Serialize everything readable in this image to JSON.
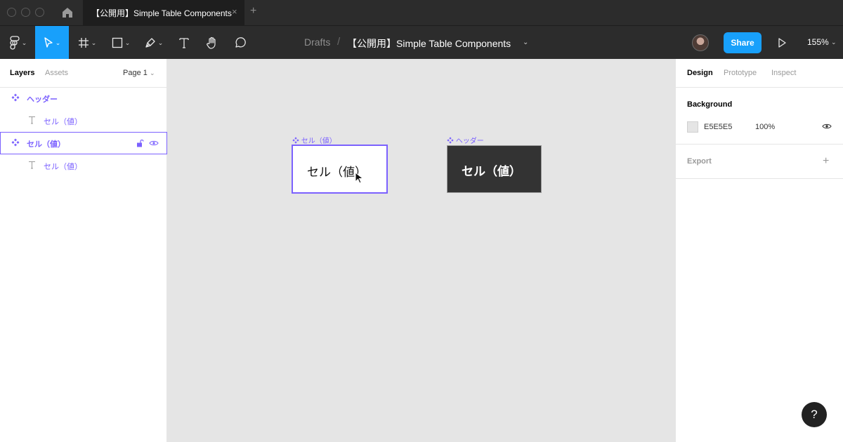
{
  "window": {
    "tab_title": "【公開用】Simple Table Components",
    "tab_close": "×",
    "new_tab": "+"
  },
  "toolbar": {
    "breadcrumb": "Drafts",
    "separator": "/",
    "file_name": "【公開用】Simple Table Components",
    "share_label": "Share",
    "zoom": "155%"
  },
  "layers_panel": {
    "tabs": [
      "Layers",
      "Assets"
    ],
    "page_selector": "Page 1",
    "items": [
      {
        "label": "ヘッダー",
        "type": "component"
      },
      {
        "label": "セル（値）",
        "type": "text"
      },
      {
        "label": "セル（値）",
        "type": "component",
        "selected": true
      },
      {
        "label": "セル（値）",
        "type": "text"
      }
    ]
  },
  "canvas": {
    "cell_frame_label": "セル（値）",
    "cell_text": "セル（値）",
    "header_frame_label": "ヘッダー",
    "header_text": "セル（値）"
  },
  "design_panel": {
    "tabs": [
      "Design",
      "Prototype",
      "Inspect"
    ],
    "background_title": "Background",
    "background_hex": "E5E5E5",
    "background_opacity": "100%",
    "export_title": "Export"
  },
  "help_label": "?",
  "colors": {
    "accent": "#18a0fb",
    "component": "#7b61ff",
    "toolbar_bg": "#2c2c2c",
    "canvas_bg": "#e5e5e5"
  }
}
